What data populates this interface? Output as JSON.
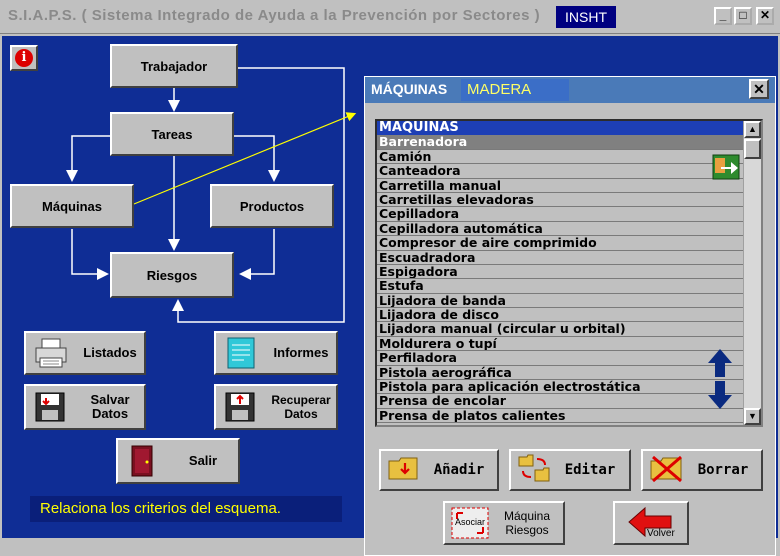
{
  "window": {
    "title": "S.I.A.P.S.  ( Sistema Integrado de Ayuda a la Prevención por Sectores )",
    "badge": "INSHT",
    "min": "_",
    "max": "□",
    "close": "✕"
  },
  "diagram": {
    "trabajador": "Trabajador",
    "tareas": "Tareas",
    "maquinas": "Máquinas",
    "productos": "Productos",
    "riesgos": "Riesgos"
  },
  "info_button": "i",
  "buttons": {
    "listados": "Listados",
    "informes": "Informes",
    "salvar_line1": "Salvar",
    "salvar_line2": "Datos",
    "recuperar_line1": "Recuperar",
    "recuperar_line2": "Datos",
    "salir": "Salir"
  },
  "status": "Relaciona los criterios del esquema.",
  "panel": {
    "title": "MÁQUINAS",
    "value": "MADERA",
    "close": "✕",
    "list_header": "MÁQUINAS",
    "items": [
      "Barrenadora",
      "Camión",
      "Canteadora",
      "Carretilla manual",
      "Carretillas elevadoras",
      "Cepilladora",
      "Cepilladora automática",
      "Compresor de aire comprimido",
      "Escuadradora",
      "Espigadora",
      "Estufa",
      "Lijadora de banda",
      "Lijadora de disco",
      "Lijadora manual (circular u orbital)",
      "Moldurera o tupí",
      "Perfiladora",
      "Pistola aerográfica",
      "Pistola para aplicación electrostática",
      "Prensa de encolar",
      "Prensa de platos calientes"
    ],
    "selected_index": 0,
    "scroll_up": "▲",
    "scroll_down": "▼",
    "actions": {
      "anadir": "Añadir",
      "editar": "Editar",
      "borrar": "Borrar",
      "asociar_icon_text": "Asociar",
      "maquina_riesgos_line1": "Máquina",
      "maquina_riesgos_line2": "Riesgos",
      "volver": "Volver"
    }
  },
  "colors": {
    "background": "#0f2d95",
    "accent_yellow": "#ffff00",
    "list_header": "#1d3fb5"
  }
}
